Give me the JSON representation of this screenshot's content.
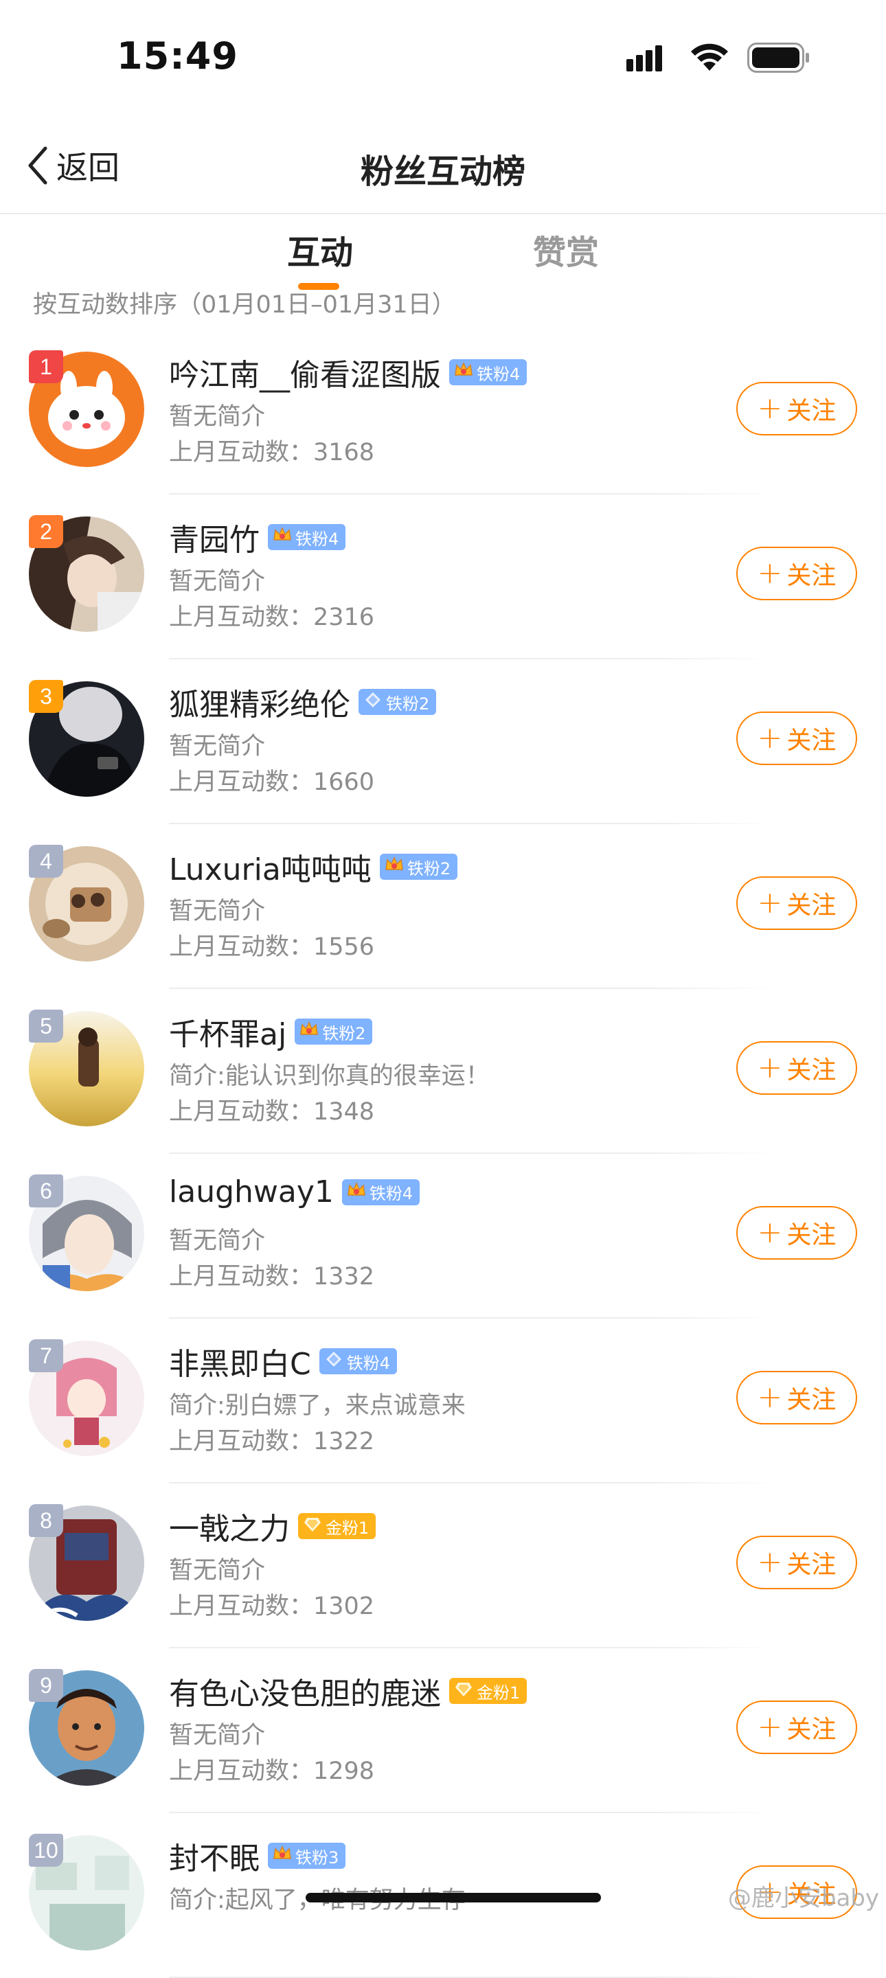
{
  "status_bar": {
    "time": "15:49"
  },
  "nav": {
    "back_label": "返回",
    "title": "粉丝互动榜"
  },
  "tabs": [
    {
      "label": "互动",
      "active": true
    },
    {
      "label": "赞赏",
      "active": false
    }
  ],
  "sort_info": "按互动数排序（01月01日–01月31日）",
  "follow_label": "关注",
  "colors": {
    "accent": "#ff8200",
    "rank1": "#f04646",
    "rank2": "#ff7a2e",
    "rank3": "#ff9f0a",
    "rank_other": "#a9b1c7",
    "badge_blue": "#7fb2ff",
    "badge_gold": "#ffb31a"
  },
  "fans": [
    {
      "rank": "1",
      "name": "吟江南__偷看涩图版",
      "badge": "铁粉4",
      "badge_type": "blue",
      "badge_icon": "crown-icon",
      "desc": "暂无简介",
      "count_label": "上月互动数：3168"
    },
    {
      "rank": "2",
      "name": "青园竹",
      "badge": "铁粉4",
      "badge_type": "blue",
      "badge_icon": "crown-icon",
      "desc": "暂无简介",
      "count_label": "上月互动数：2316"
    },
    {
      "rank": "3",
      "name": "狐狸精彩绝伦",
      "badge": "铁粉2",
      "badge_type": "blue",
      "badge_icon": "diamond-icon",
      "desc": "暂无简介",
      "count_label": "上月互动数：1660"
    },
    {
      "rank": "4",
      "name": "Luxuria吨吨吨",
      "badge": "铁粉2",
      "badge_type": "blue",
      "badge_icon": "crown-icon",
      "desc": "暂无简介",
      "count_label": "上月互动数：1556"
    },
    {
      "rank": "5",
      "name": "千杯罪aj",
      "badge": "铁粉2",
      "badge_type": "blue",
      "badge_icon": "crown-icon",
      "desc": "简介:能认识到你真的很幸运！",
      "count_label": "上月互动数：1348"
    },
    {
      "rank": "6",
      "name": "laughway1",
      "badge": "铁粉4",
      "badge_type": "blue",
      "badge_icon": "crown-icon",
      "desc": "暂无简介",
      "count_label": "上月互动数：1332"
    },
    {
      "rank": "7",
      "name": "非黑即白C",
      "badge": "铁粉4",
      "badge_type": "blue",
      "badge_icon": "diamond-icon",
      "desc": "简介:别白嫖了，来点诚意来",
      "count_label": "上月互动数：1322"
    },
    {
      "rank": "8",
      "name": "一戟之力",
      "badge": "金粉1",
      "badge_type": "gold",
      "badge_icon": "gem-icon",
      "desc": "暂无简介",
      "count_label": "上月互动数：1302"
    },
    {
      "rank": "9",
      "name": "有色心没色胆的鹿迷",
      "badge": "金粉1",
      "badge_type": "gold",
      "badge_icon": "gem-icon",
      "desc": "暂无简介",
      "count_label": "上月互动数：1298"
    },
    {
      "rank": "10",
      "name": "封不眠",
      "badge": "铁粉3",
      "badge_type": "blue",
      "badge_icon": "crown-icon",
      "desc": "简介:起风了，唯有努力生存",
      "count_label": ""
    }
  ],
  "watermark": "@鹿小安baby"
}
